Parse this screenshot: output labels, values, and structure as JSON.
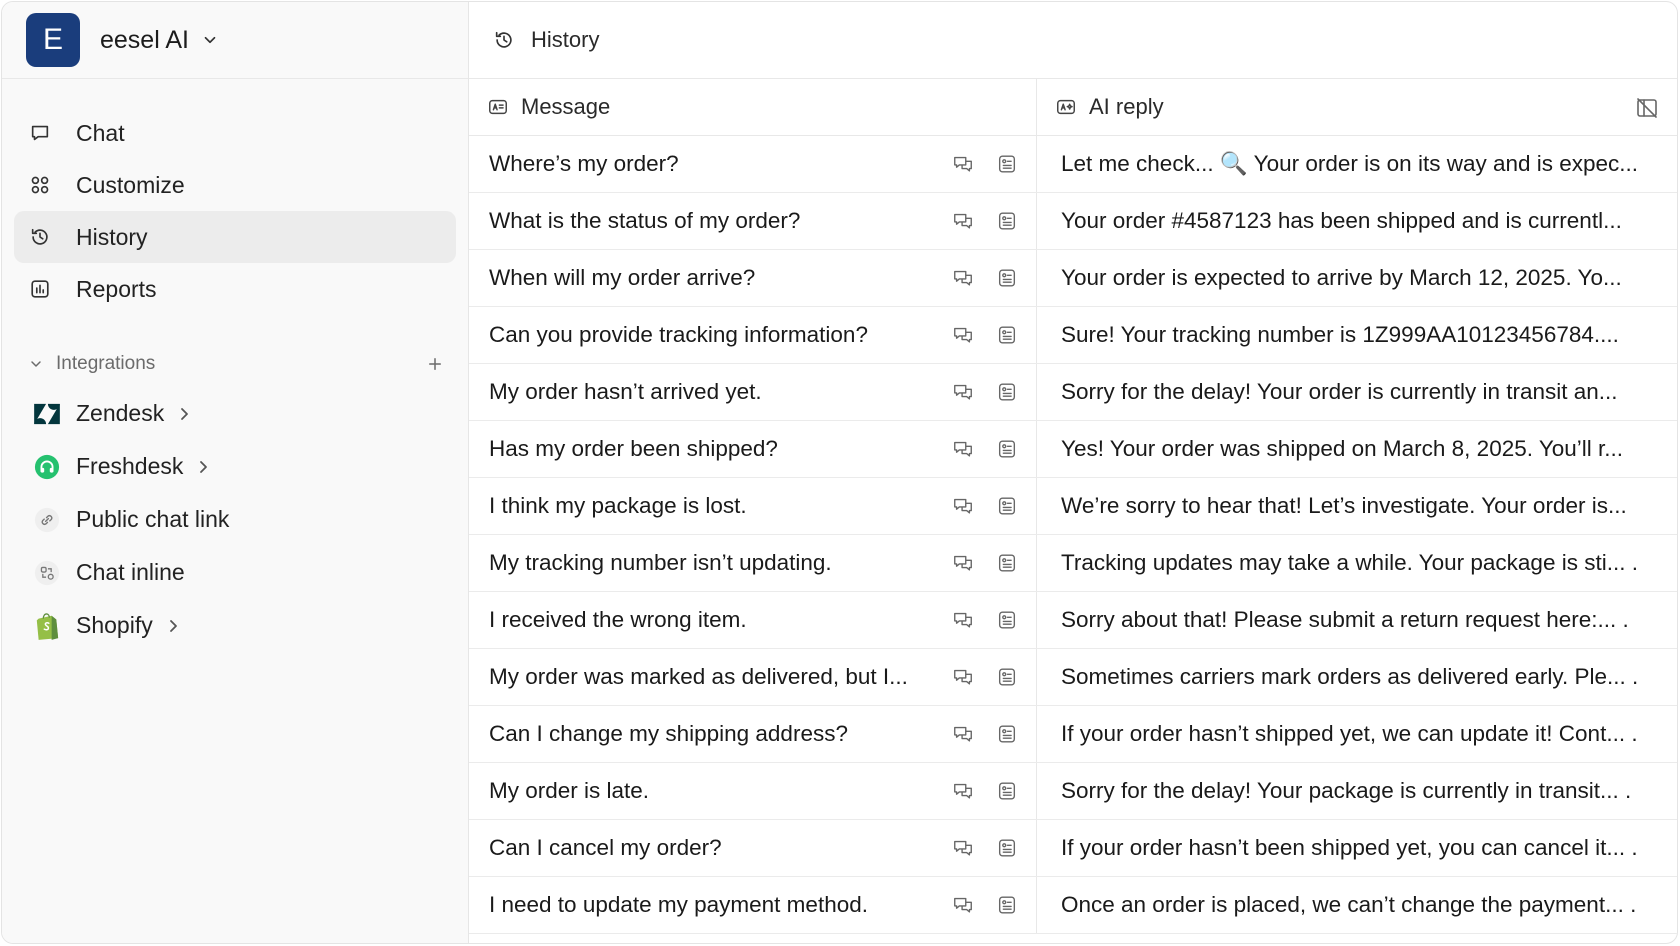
{
  "workspace": {
    "initial": "E",
    "name": "eesel AI"
  },
  "nav": [
    {
      "label": "Chat",
      "icon": "chat-bubble-icon",
      "active": false
    },
    {
      "label": "Customize",
      "icon": "customize-grid-icon",
      "active": false
    },
    {
      "label": "History",
      "icon": "history-icon",
      "active": true
    },
    {
      "label": "Reports",
      "icon": "reports-chart-icon",
      "active": false
    }
  ],
  "integrations": {
    "title": "Integrations",
    "items": [
      {
        "label": "Zendesk",
        "icon": "zendesk-logo",
        "has_arrow": true
      },
      {
        "label": "Freshdesk",
        "icon": "freshdesk-logo",
        "has_arrow": true
      },
      {
        "label": "Public chat link",
        "icon": "link-icon",
        "has_arrow": false
      },
      {
        "label": "Chat inline",
        "icon": "chat-inline-icon",
        "has_arrow": false
      },
      {
        "label": "Shopify",
        "icon": "shopify-logo",
        "has_arrow": true
      }
    ]
  },
  "topbar": {
    "title": "History"
  },
  "table": {
    "columns": {
      "message": "Message",
      "ai_reply": "AI reply"
    },
    "rows": [
      {
        "message": "Where’s my order?",
        "reply": "Let me check... 🔍 Your order is on its way and is expec..."
      },
      {
        "message": "What is the status of my order?",
        "reply": "Your order #4587123 has been shipped and is currentl..."
      },
      {
        "message": "When will my order arrive?",
        "reply": "Your order is expected to arrive by March 12, 2025. Yo..."
      },
      {
        "message": "Can you provide tracking information?",
        "reply": "Sure! Your tracking number is 1Z999AA10123456784...."
      },
      {
        "message": "My order hasn’t arrived yet.",
        "reply": "Sorry for the delay! Your order is currently in transit an..."
      },
      {
        "message": "Has my order been shipped?",
        "reply": "Yes! Your order was shipped on March 8, 2025. You’ll r..."
      },
      {
        "message": "I think my package is lost.",
        "reply": "We’re sorry to hear that! Let’s investigate. Your order is..."
      },
      {
        "message": "My tracking number isn’t updating.",
        "reply": "Tracking updates may take a while. Your package is sti... ."
      },
      {
        "message": "I received the wrong item.",
        "reply": "Sorry about that! Please submit a return request here:... ."
      },
      {
        "message": "My order was marked as delivered, but I...",
        "reply": "Sometimes carriers mark orders as delivered early. Ple... ."
      },
      {
        "message": "Can I change my shipping address?",
        "reply": "If your order hasn’t shipped yet, we can update it! Cont... ."
      },
      {
        "message": "My order is late.",
        "reply": "Sorry for the delay! Your package is currently in transit... ."
      },
      {
        "message": "Can I cancel my order?",
        "reply": "If your order hasn’t been shipped yet, you can cancel it... ."
      },
      {
        "message": "I need to update my payment method.",
        "reply": "Once an order is placed, we can’t change the payment... ."
      }
    ]
  },
  "colors": {
    "workspace_logo_bg": "#1a3d7c",
    "active_nav_bg": "#ececec",
    "zendesk": "#03363d",
    "freshdesk": "#25c16f",
    "shopify": "#95bf47"
  }
}
